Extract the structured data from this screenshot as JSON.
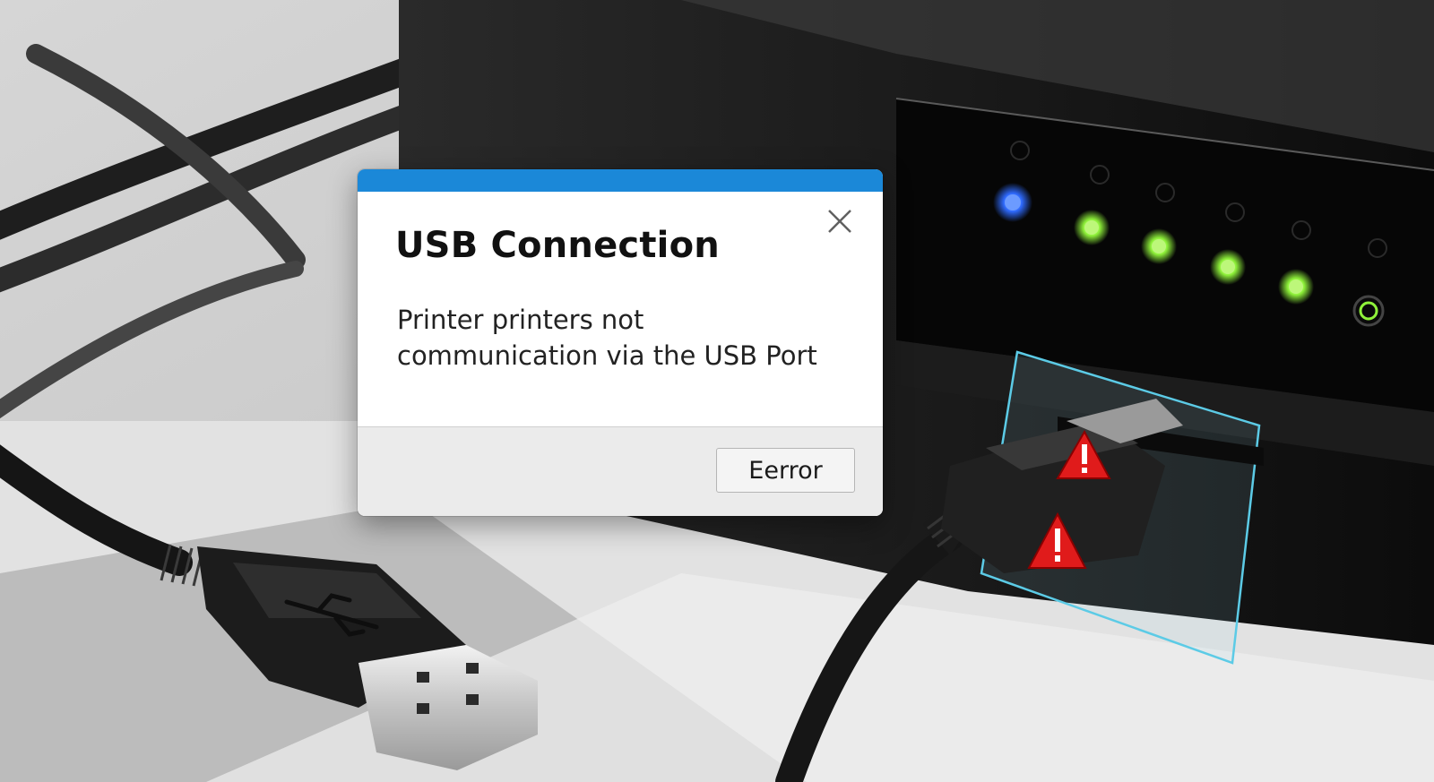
{
  "dialog": {
    "title": "USB Connection",
    "message": "Printer printers not communication via the USB Port",
    "button_label": "Eerror",
    "accent_color": "#1b88d8"
  },
  "icons": {
    "close": "close-icon",
    "warning": "warning-triangle-icon",
    "usb": "usb-symbol-icon"
  },
  "colors": {
    "title_bar": "#1b88d8",
    "warning_red": "#e01b1b",
    "led_blue": "#2f6bff",
    "led_green": "#8ff23a",
    "port_highlight": "#5ccbe6"
  },
  "printer": {
    "status_lights": [
      "blue",
      "green",
      "green",
      "green",
      "green",
      "green-ring"
    ]
  }
}
